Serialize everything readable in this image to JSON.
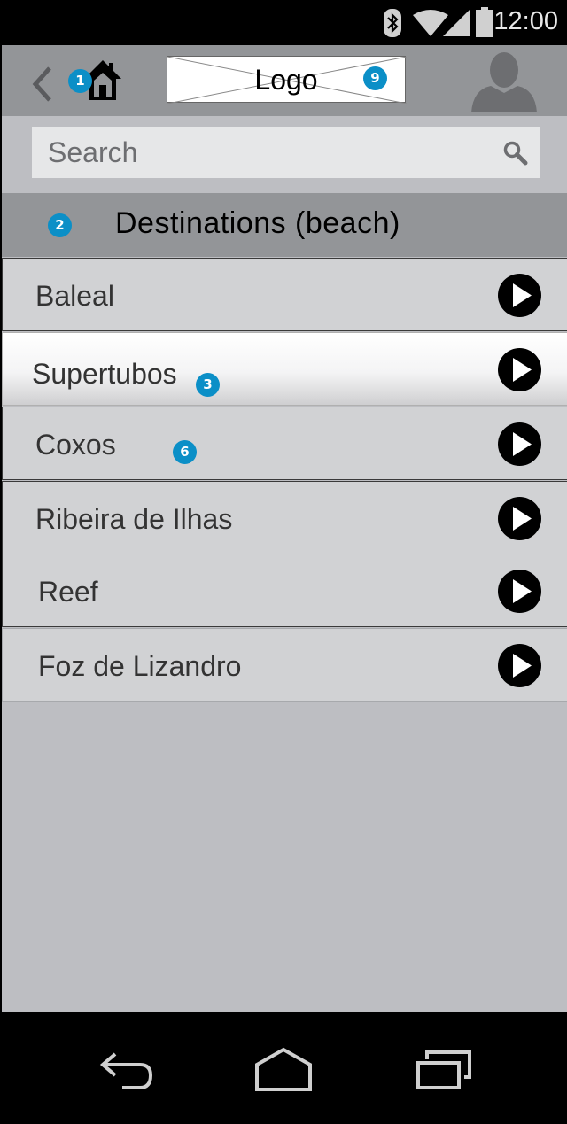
{
  "status_bar": {
    "time": "12:00"
  },
  "header": {
    "logo_text": "Logo",
    "badges": {
      "home": "1",
      "logo": "9"
    }
  },
  "search": {
    "placeholder": "Search"
  },
  "section": {
    "title": "Destinations (beach)",
    "badge": "2"
  },
  "destinations": [
    {
      "label": "Baleal"
    },
    {
      "label": "Supertubos",
      "badge": "3"
    },
    {
      "label": "Coxos",
      "badge": "6"
    },
    {
      "label": "Ribeira de Ilhas"
    },
    {
      "label": "Reef"
    },
    {
      "label": "Foz de Lizandro"
    }
  ],
  "colors": {
    "badge": "#0b8fc7",
    "top_bar": "#939598",
    "screen_bg": "#bdbec2",
    "list_item": "#d1d2d4"
  },
  "icons": [
    "bluetooth-icon",
    "wifi-icon",
    "signal-icon",
    "battery-icon",
    "back-chevron-icon",
    "home-icon",
    "avatar-icon",
    "search-icon",
    "play-icon",
    "nav-back-icon",
    "nav-home-icon",
    "nav-recents-icon"
  ]
}
